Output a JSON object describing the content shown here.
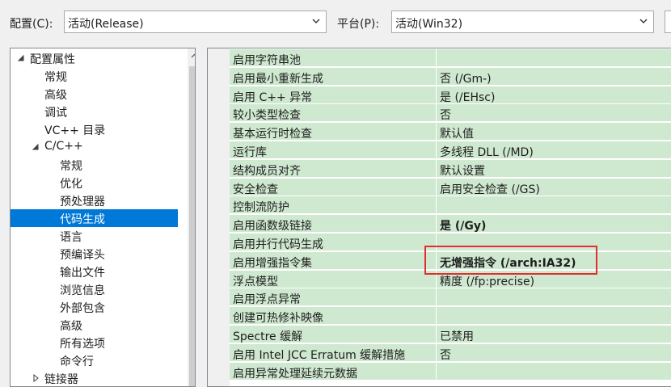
{
  "toolbar": {
    "config_label": "配置(C):",
    "config_value": "活动(Release)",
    "platform_label": "平台(P):",
    "platform_value": "活动(Win32)"
  },
  "tree": {
    "items": [
      {
        "label": "配置属性",
        "expanded": true
      },
      {
        "label": "常规"
      },
      {
        "label": "高级"
      },
      {
        "label": "调试"
      },
      {
        "label": "VC++ 目录"
      },
      {
        "label": "C/C++",
        "expanded": true
      },
      {
        "label": "常规"
      },
      {
        "label": "优化"
      },
      {
        "label": "预处理器"
      },
      {
        "label": "代码生成",
        "selected": true
      },
      {
        "label": "语言"
      },
      {
        "label": "预编译头"
      },
      {
        "label": "输出文件"
      },
      {
        "label": "浏览信息"
      },
      {
        "label": "外部包含"
      },
      {
        "label": "高级"
      },
      {
        "label": "所有选项"
      },
      {
        "label": "命令行"
      },
      {
        "label": "链接器",
        "expanded": false
      }
    ]
  },
  "properties": [
    {
      "name": "启用字符串池",
      "value": ""
    },
    {
      "name": "启用最小重新生成",
      "value": "否 (/Gm-)"
    },
    {
      "name": "启用 C++ 异常",
      "value": "是 (/EHsc)"
    },
    {
      "name": "较小类型检查",
      "value": "否"
    },
    {
      "name": "基本运行时检查",
      "value": "默认值"
    },
    {
      "name": "运行库",
      "value": "多线程 DLL (/MD)"
    },
    {
      "name": "结构成员对齐",
      "value": "默认设置"
    },
    {
      "name": "安全检查",
      "value": "启用安全检查 (/GS)"
    },
    {
      "name": "控制流防护",
      "value": ""
    },
    {
      "name": "启用函数级链接",
      "value": "是 (/Gy)",
      "bold": true
    },
    {
      "name": "启用并行代码生成",
      "value": ""
    },
    {
      "name": "启用增强指令集",
      "value": "无增强指令 (/arch:IA32)",
      "bold": true,
      "highlighted": true
    },
    {
      "name": "浮点模型",
      "value": "精度 (/fp:precise)"
    },
    {
      "name": "启用浮点异常",
      "value": ""
    },
    {
      "name": "创建可热修补映像",
      "value": ""
    },
    {
      "name": "Spectre 缓解",
      "value": "已禁用"
    },
    {
      "name": "启用 Intel JCC Erratum 缓解措施",
      "value": "否"
    },
    {
      "name": "启用异常处理延续元数据",
      "value": ""
    }
  ],
  "colors": {
    "grid_row_bg": "#cfe8d0",
    "selection": "#0078d7",
    "highlight_box": "#e0302e"
  }
}
